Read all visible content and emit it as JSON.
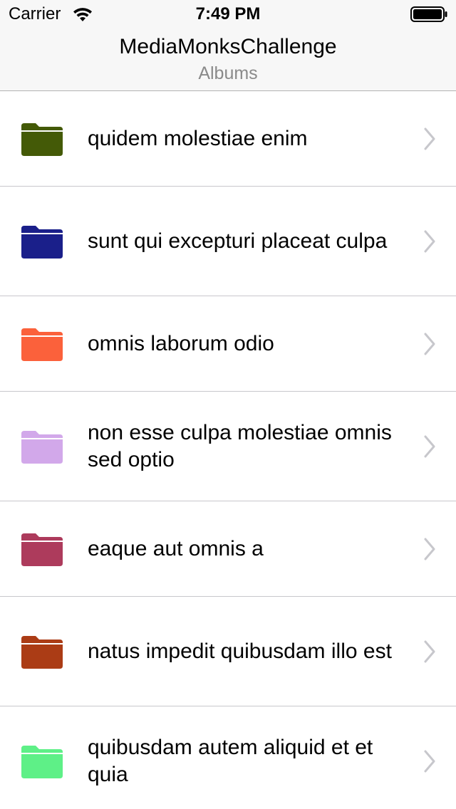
{
  "status_bar": {
    "carrier": "Carrier",
    "time": "7:49 PM",
    "wifi_icon": "wifi-icon",
    "battery_icon": "battery-icon"
  },
  "nav": {
    "title": "MediaMonksChallenge",
    "subtitle": "Albums"
  },
  "albums": [
    {
      "title": "quidem molestiae enim",
      "folder_color": "#445a07",
      "icon": "folder-icon",
      "accessory": "chevron-right-icon"
    },
    {
      "title": "sunt qui excepturi placeat culpa",
      "folder_color": "#1a1f8a",
      "icon": "folder-icon",
      "accessory": "chevron-right-icon"
    },
    {
      "title": "omnis laborum odio",
      "folder_color": "#fb613b",
      "icon": "folder-icon",
      "accessory": "chevron-right-icon"
    },
    {
      "title": "non esse culpa molestiae omnis sed optio",
      "folder_color": "#d2a8ea",
      "icon": "folder-icon",
      "accessory": "chevron-right-icon"
    },
    {
      "title": "eaque aut omnis a",
      "folder_color": "#ad3b5c",
      "icon": "folder-icon",
      "accessory": "chevron-right-icon"
    },
    {
      "title": "natus impedit quibusdam illo est",
      "folder_color": "#ab3c15",
      "icon": "folder-icon",
      "accessory": "chevron-right-icon"
    },
    {
      "title": "quibusdam autem aliquid et et quia",
      "folder_color": "#5ef087",
      "icon": "folder-icon",
      "accessory": "chevron-right-icon"
    }
  ],
  "colors": {
    "status_bar_bg": "#f7f7f7",
    "subtitle": "#8a8a8a",
    "separator": "#c8c7cc",
    "chevron": "#c7c7cc"
  }
}
